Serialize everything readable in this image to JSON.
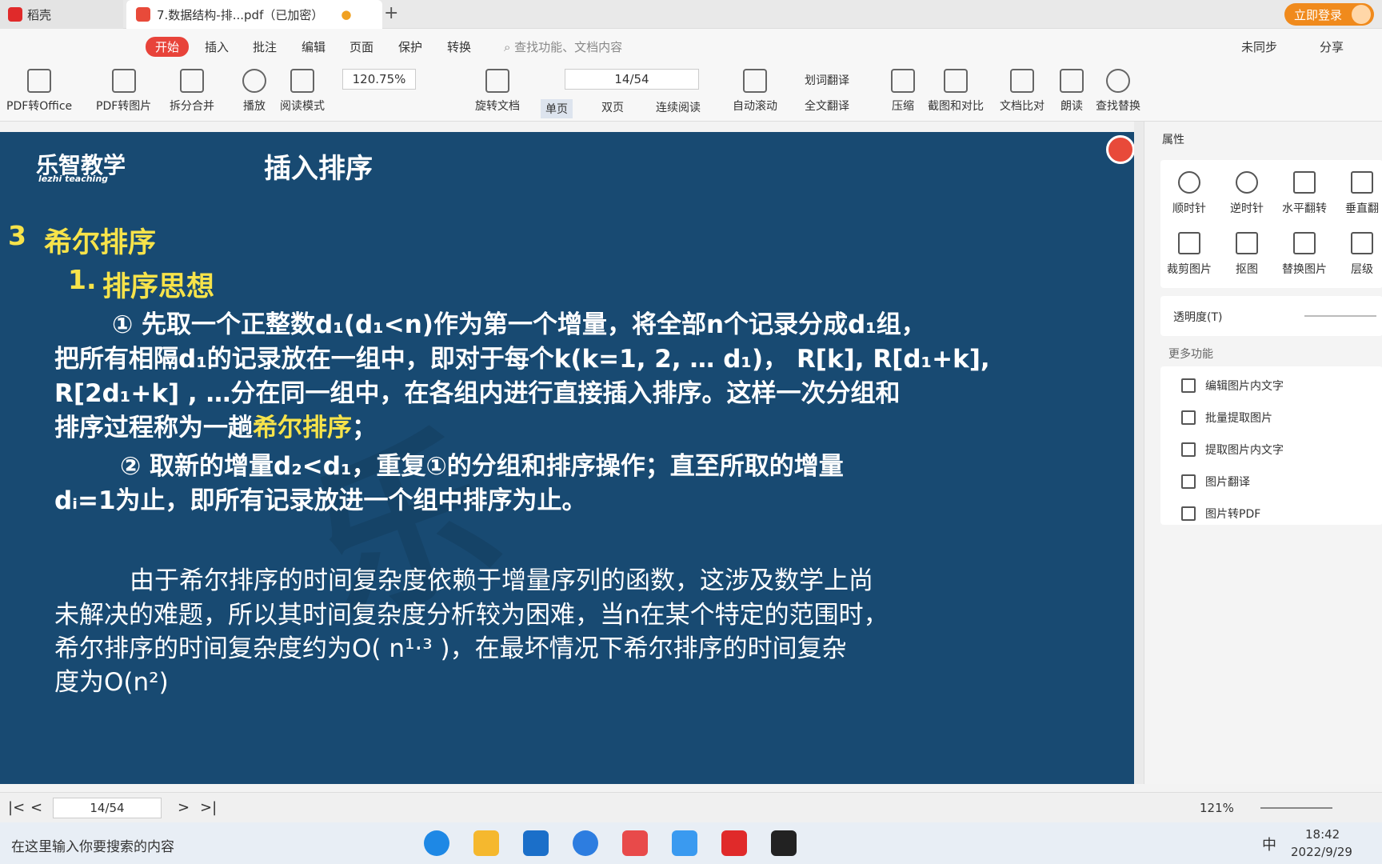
{
  "titlebar": {
    "tab1": "稻壳",
    "tab2": "7.数据结构-排...pdf（已加密）",
    "login": "立即登录"
  },
  "menu": {
    "active": "开始",
    "items": [
      "插入",
      "批注",
      "编辑",
      "页面",
      "保护",
      "转换"
    ],
    "search": "查找功能、文档内容",
    "sync": "未同步",
    "share": "分享"
  },
  "ribbon": {
    "pdf_office": "PDF转Office",
    "pdf_img": "PDF转图片",
    "split": "拆分合并",
    "play": "播放",
    "read": "阅读模式",
    "zoom": "120.75%",
    "rotate": "旋转文档",
    "page": "14/54",
    "single": "单页",
    "double": "双页",
    "continuous": "连续阅读",
    "autoscroll": "自动滚动",
    "word_translate": "划词翻译",
    "full_translate": "全文翻译",
    "compress": "压缩",
    "screenshot": "截图和对比",
    "compare": "文档比对",
    "read_aloud": "朗读",
    "find_replace": "查找替换"
  },
  "doc": {
    "logo": "乐智教学",
    "logo_sub": "lezhi teaching",
    "title": "插入排序",
    "section_num": "3",
    "section": "希尔排序",
    "sub_num": "1.",
    "sub": "排序思想",
    "p1a": "① 先取一个正整数d₁(d₁<n)作为第一个增量，将全部n个记录分成d₁组，",
    "p1b": "把所有相隔d₁的记录放在一组中，即对于每个k(k=1, 2, … d₁)， R[k], R[d₁+k],",
    "p1c": "R[2d₁+k] , …分在同一组中，在各组内进行直接插入排序。这样一次分组和",
    "p1d": "排序过程称为一趟",
    "p1d_yellow": "希尔排序",
    "p1d_end": "；",
    "p2a": "② 取新的增量d₂<d₁，重复①的分组和排序操作；直至所取的增量",
    "p2b": "dᵢ=1为止，即所有记录放进一个组中排序为止。",
    "p3a": "由于希尔排序的时间复杂度依赖于增量序列的函数，这涉及数学上尚",
    "p3b": "未解决的难题，所以其时间复杂度分析较为困难，当n在某个特定的范围时，",
    "p3c": "希尔排序的时间复杂度约为O( n¹·³ )，在最坏情况下希尔排序的时间复杂",
    "p3d": "度为O(n²)"
  },
  "panel": {
    "title": "属性",
    "items": [
      "顺时针",
      "逆时针",
      "水平翻转",
      "垂直翻",
      "裁剪图片",
      "抠图",
      "替换图片",
      "层级"
    ],
    "opacity": "透明度(T)",
    "more": "更多功能",
    "functions": [
      "编辑图片内文字",
      "批量提取图片",
      "提取图片内文字",
      "图片翻译",
      "图片转PDF"
    ]
  },
  "status": {
    "page": "14/54",
    "zoom": "121%"
  },
  "taskbar": {
    "search": "在这里输入你要搜索的内容",
    "time": "18:42",
    "date": "2022/9/29",
    "ime": "中"
  }
}
